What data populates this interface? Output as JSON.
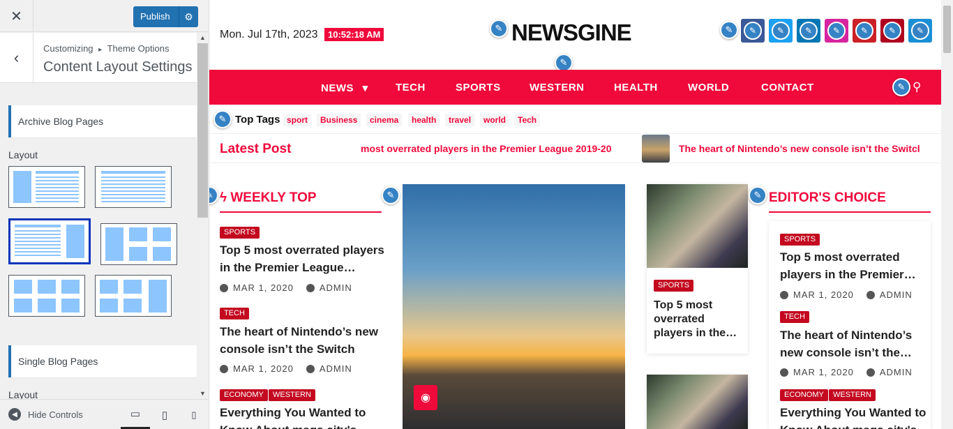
{
  "customizer": {
    "publish_label": "Publish",
    "breadcrumb_root": "Customizing",
    "breadcrumb_sep": "▸",
    "breadcrumb_current": "Theme Options",
    "panel_title": "Content Layout Settings",
    "section_archive": "Archive Blog Pages",
    "layout_label": "Layout",
    "section_single": "Single Blog Pages",
    "layout_label_2": "Layout",
    "hide_controls": "Hide Controls"
  },
  "icons": {
    "close": "✕",
    "back": "‹",
    "gear": "⚙",
    "pencil": "✎",
    "search": "⚲",
    "camera": "◉",
    "bolt": "ϟ",
    "hide": "◀",
    "desktop": "▭",
    "tablet": "▯",
    "mobile": "▯",
    "caret": "▾",
    "up": "▲",
    "down": "▼"
  },
  "header": {
    "date": "Mon. Jul 17th, 2023",
    "time": "10:52:18 AM",
    "logo": "NEWSGINE"
  },
  "social_colors": [
    "#3b5998",
    "#1da1f2",
    "#0077b5",
    "#d6249f",
    "#cb2027",
    "#b00020",
    "#1a8fd6"
  ],
  "nav": [
    "NEWS",
    "TECH",
    "SPORTS",
    "WESTERN",
    "HEALTH",
    "WORLD",
    "CONTACT"
  ],
  "top_tags": {
    "title": "Top Tags",
    "tags": [
      "sport",
      "Business",
      "cinema",
      "health",
      "travel",
      "world",
      "Tech"
    ]
  },
  "latest": {
    "title": "Latest Post",
    "ticker": [
      "most overrated players in the Premier League 2019-20",
      "The heart of Nintendo’s new console isn’t the Switcl"
    ]
  },
  "weekly": {
    "title": "WEEKLY TOP",
    "posts": [
      {
        "cats": [
          "SPORTS"
        ],
        "title1": "Top 5 most overrated players",
        "title2": "in the Premier League…",
        "date": "MAR 1, 2020",
        "author": "ADMIN"
      },
      {
        "cats": [
          "TECH"
        ],
        "title1": "The heart of Nintendo’s new",
        "title2": "console isn’t the Switch",
        "date": "MAR 1, 2020",
        "author": "ADMIN"
      },
      {
        "cats": [
          "ECONOMY",
          "WESTERN"
        ],
        "title1": "Everything You Wanted to",
        "title2": "Know About mega city's",
        "date": "",
        "author": ""
      }
    ]
  },
  "middle_card": {
    "cat": "SPORTS",
    "title1": "Top 5 most",
    "title2": "overrated",
    "title3": "players in the…"
  },
  "editors": {
    "title": "EDITOR'S CHOICE",
    "posts": [
      {
        "cats": [
          "SPORTS"
        ],
        "title1": "Top 5 most overrated",
        "title2": "players in the Premier…",
        "date": "MAR 1, 2020",
        "author": "ADMIN"
      },
      {
        "cats": [
          "TECH"
        ],
        "title1": "The heart of Nintendo’s",
        "title2": "new console isn’t the…",
        "date": "MAR 1, 2020",
        "author": "ADMIN"
      },
      {
        "cats": [
          "ECONOMY",
          "WESTERN"
        ],
        "title1": "Everything You Wanted to",
        "title2": "Know About mega city's",
        "date": "",
        "author": ""
      }
    ]
  },
  "colors": {
    "accent": "#f0093b",
    "category": "#c3081f",
    "wp_blue": "#2271b1",
    "pencil_blue": "#3582c4"
  }
}
